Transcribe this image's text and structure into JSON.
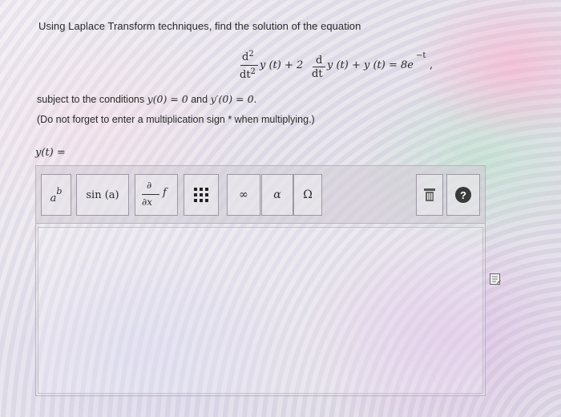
{
  "question": {
    "instruction": "Using Laplace Transform techniques, find the solution of the equation",
    "equation": {
      "d_num": "d",
      "sq": "2",
      "dt_den": "dt",
      "y_t_1": "y (t) + 2",
      "y_t_2": "y (t) + y (t) = 8e",
      "exp": "−t",
      "comma": ","
    },
    "conditions_prefix": "subject to the conditions ",
    "condition_1": "y(0) = 0",
    "conditions_and": " and ",
    "condition_2": "y′(0) = 0.",
    "note": "(Do not forget to enter a multiplication sign * when multiplying.)",
    "answer_label": "y(t) ="
  },
  "toolbar": {
    "superscript": {
      "base": "a",
      "exp": "b"
    },
    "sin": "sin (a)",
    "partial": {
      "num": "∂",
      "den": "∂x",
      "f": "f"
    },
    "infinity": "∞",
    "alpha": "α",
    "omega": "Ω",
    "help": "?"
  },
  "answer": {
    "value": ""
  }
}
